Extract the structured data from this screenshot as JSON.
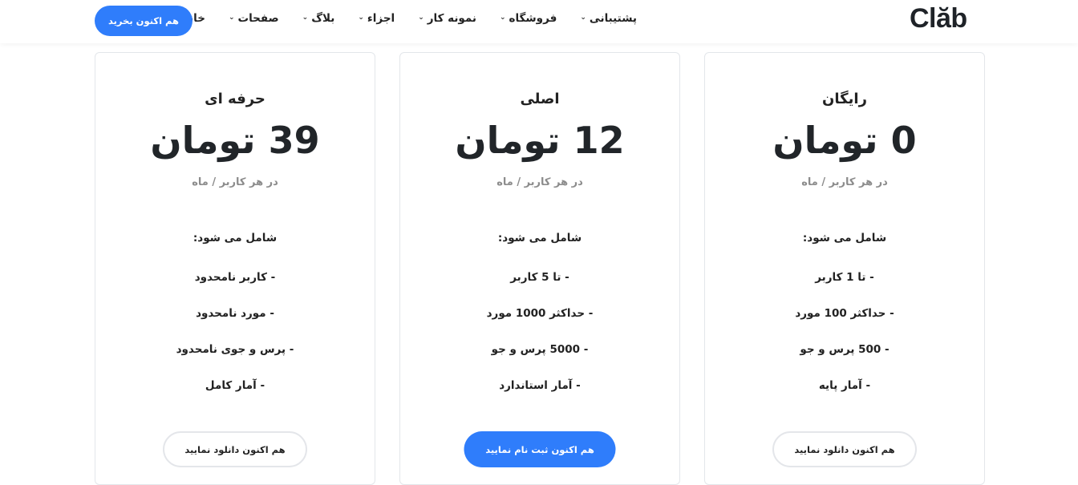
{
  "header": {
    "logo": "Clăb",
    "nav": [
      {
        "label": "خانه"
      },
      {
        "label": "صفحات"
      },
      {
        "label": "بلاگ"
      },
      {
        "label": "اجزاء"
      },
      {
        "label": "نمونه کار"
      },
      {
        "label": "فروشگاه"
      },
      {
        "label": "پشتیبانی"
      }
    ],
    "cta_label": "هم اکنون بخرید"
  },
  "colors": {
    "accent": "#2f7dfb",
    "text": "#1f2328",
    "muted": "#8c8c8c",
    "border": "#e3e6ea"
  },
  "plans": [
    {
      "name": "رایگان",
      "price": "0 تومان",
      "period": "در هر کاربر / ماه",
      "includes_label": "شامل می شود:",
      "features": [
        "- تا 1 کاربر",
        "- حداکثر 100 مورد",
        "- 500 پرس و جو",
        "- آمار پایه"
      ],
      "button_label": "هم اکنون دانلود نمایید"
    },
    {
      "name": "اصلی",
      "price": "12 تومان",
      "period": "در هر کاربر / ماه",
      "includes_label": "شامل می شود:",
      "features": [
        "- تا 5 کاربر",
        "- حداکثر 1000 مورد",
        "- 5000 پرس و جو",
        "- آمار استاندارد"
      ],
      "button_label": "هم اکنون ثبت نام نمایید"
    },
    {
      "name": "حرفه ای",
      "price": "39 تومان",
      "period": "در هر کاربر / ماه",
      "includes_label": "شامل می شود:",
      "features": [
        "- کاربر نامحدود",
        "- مورد نامحدود",
        "- پرس و جوی نامحدود",
        "- آمار کامل"
      ],
      "button_label": "هم اکنون دانلود نمایید"
    }
  ]
}
